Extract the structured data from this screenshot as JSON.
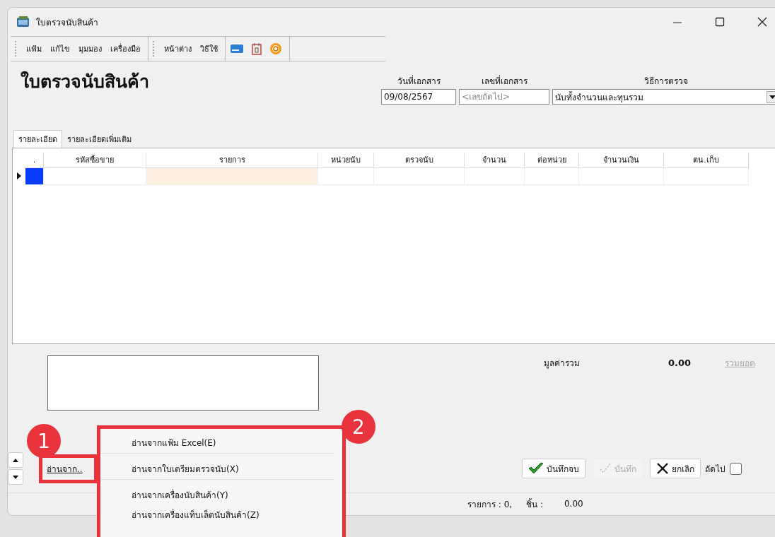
{
  "window": {
    "title": "ใบตรวจนับสินค้า"
  },
  "menu_bar": {
    "groups": [
      [
        "แฟ้ม",
        "แก้ไข",
        "มุมมอง",
        "เครื่องมือ"
      ],
      [
        "หน้าต่าง",
        "วิธีใช้"
      ]
    ]
  },
  "header": {
    "title": "ใบตรวจนับสินค้า",
    "doc_date": {
      "label": "วันที่เอกสาร",
      "value": "09/08/2567"
    },
    "doc_no": {
      "label": "เลขที่เอกสาร",
      "placeholder": "<เลขถัดไป>"
    },
    "method": {
      "label": "วิธีการตรวจ",
      "value": "นับทั้งจำนวนและทุนรวม"
    }
  },
  "tabs": [
    {
      "label": "รายละเอียด",
      "selected": true
    },
    {
      "label": "รายละเอียดเพิ่มเติม",
      "selected": false
    }
  ],
  "table": {
    "columns": [
      ".",
      "รหัสซื้อขาย",
      "รายการ",
      "หน่วยนับ",
      "ตรวจนับ",
      "จำนวน",
      "ต่อหน่วย",
      "จำนวนเงิน",
      "ตน.เก็บ"
    ]
  },
  "summary": {
    "label": "มูลค่ารวม",
    "value": "0.00",
    "link": "รวมยอด",
    "link_disabled": true
  },
  "import_link": "อ่านจาก..",
  "buttons": [
    {
      "label": "บันทึกจบ",
      "kind": "save_close",
      "disabled": false
    },
    {
      "label": "บันทึก",
      "kind": "save",
      "disabled": true
    },
    {
      "label": "ยกเลิก",
      "kind": "cancel",
      "disabled": false
    }
  ],
  "next_checkbox": {
    "label": "ถัดไป",
    "checked": false
  },
  "status_bar": {
    "items": "รายการ : 0,",
    "pieces_label": "ชิ้น :",
    "pieces_value": "0.00"
  },
  "context_menu": {
    "items": [
      {
        "label": "อ่านจากแฟ้ม Excel(E)",
        "separator_after": true
      },
      {
        "label": "อ่านจากใบเตรียมตรวจนับ(X)",
        "separator_after": true
      },
      {
        "label": "อ่านจากเครื่องนับสินค้า(Y)",
        "separator_after": false
      },
      {
        "label": "อ่านจากเครื่องแท็บเล็ตนับสินค้า(Z)",
        "separator_after": false
      }
    ]
  },
  "callouts": [
    "1",
    "2"
  ]
}
